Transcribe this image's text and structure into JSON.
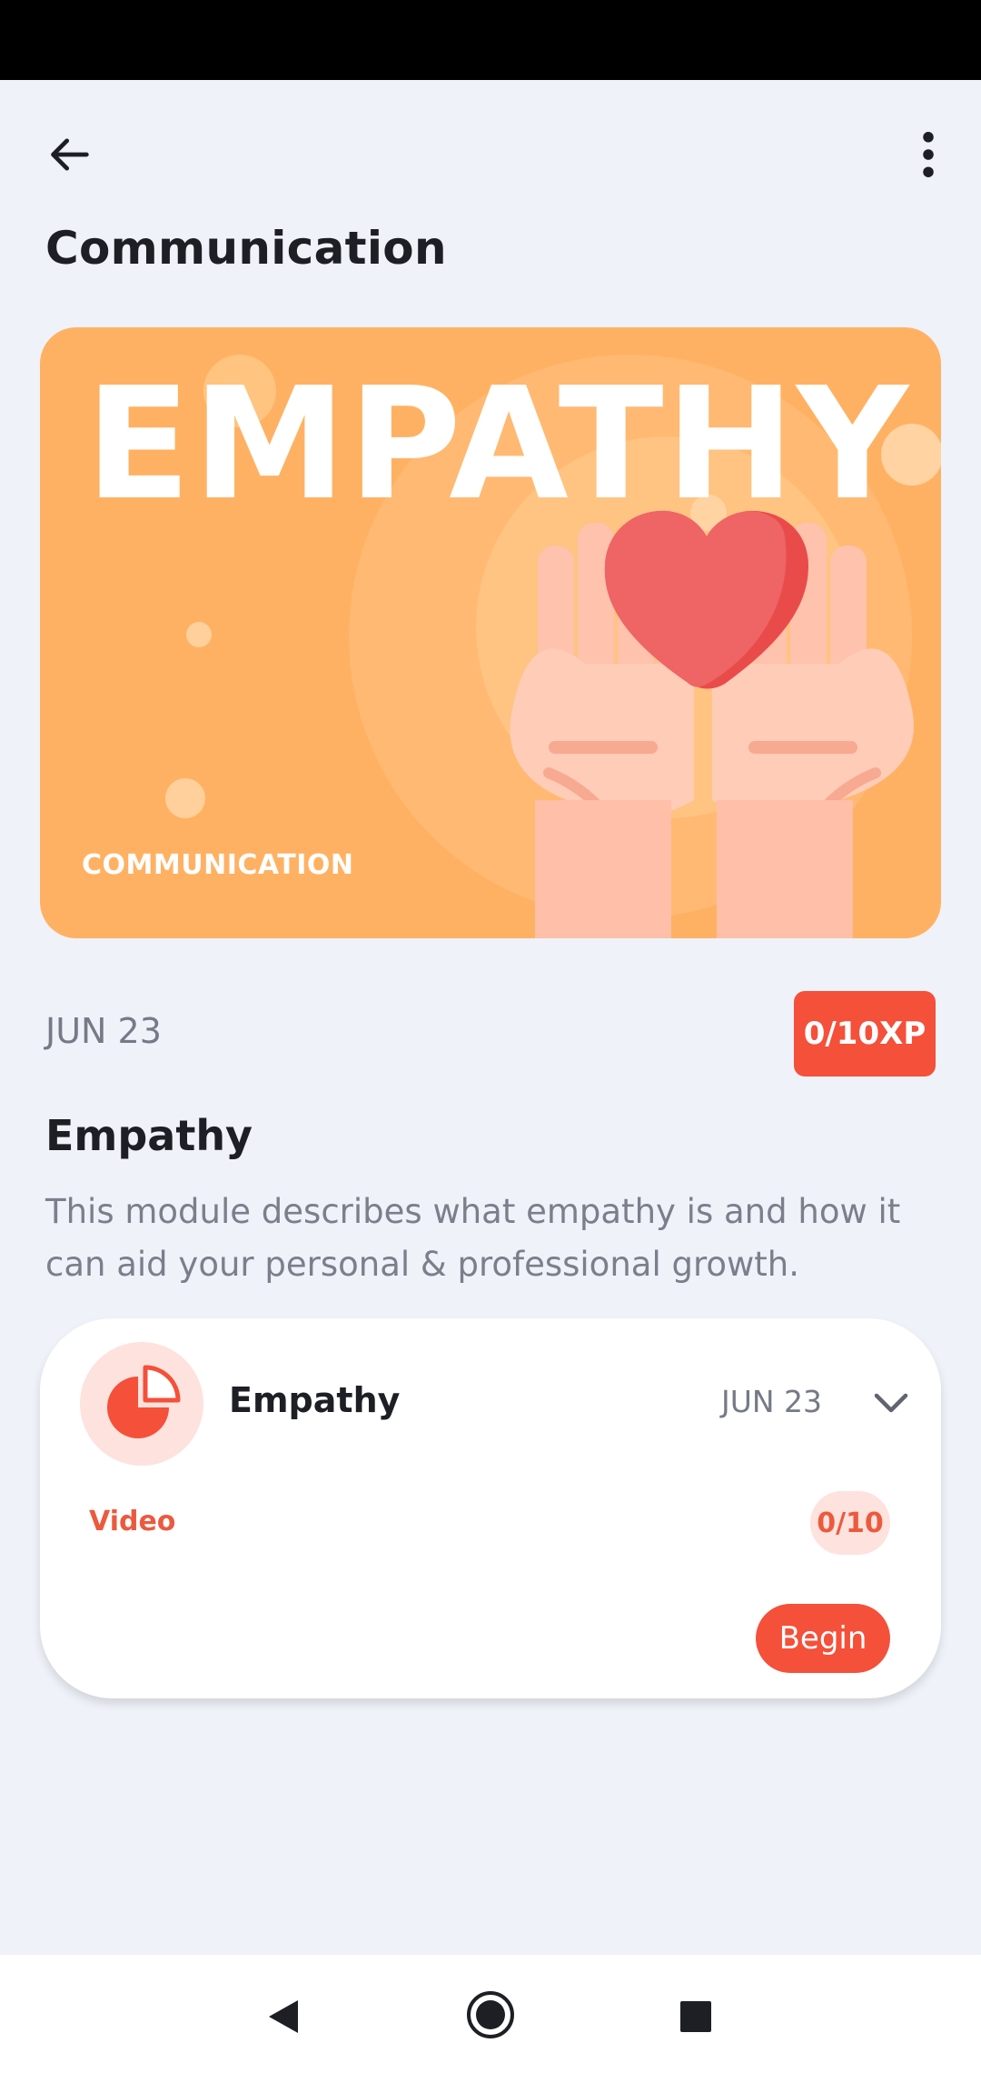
{
  "header": {
    "title": "Communication",
    "back_icon": "arrow-left-icon",
    "menu_icon": "more-vertical-icon"
  },
  "hero": {
    "title": "EMPATHY",
    "subtitle": "COMMUNICATION",
    "illustration": "heart-in-hands",
    "background_color": "#ffb163"
  },
  "module": {
    "date": "JUN 23",
    "xp": "0/10XP",
    "title": "Empathy",
    "description": "This module describes what empathy is and how it can aid your personal & professional growth."
  },
  "lesson_card": {
    "icon": "pie-chart-icon",
    "title": "Empathy",
    "date": "JUN 23",
    "type": "Video",
    "score": "0/10",
    "begin_label": "Begin",
    "expand_icon": "chevron-down-icon"
  },
  "colors": {
    "accent": "#f4503a",
    "background": "#eff2f9",
    "text": "#1d1f24",
    "muted": "#757a86"
  },
  "navigation": {
    "back_icon": "nav-back-icon",
    "home_icon": "nav-home-icon",
    "recents_icon": "nav-recents-icon"
  }
}
